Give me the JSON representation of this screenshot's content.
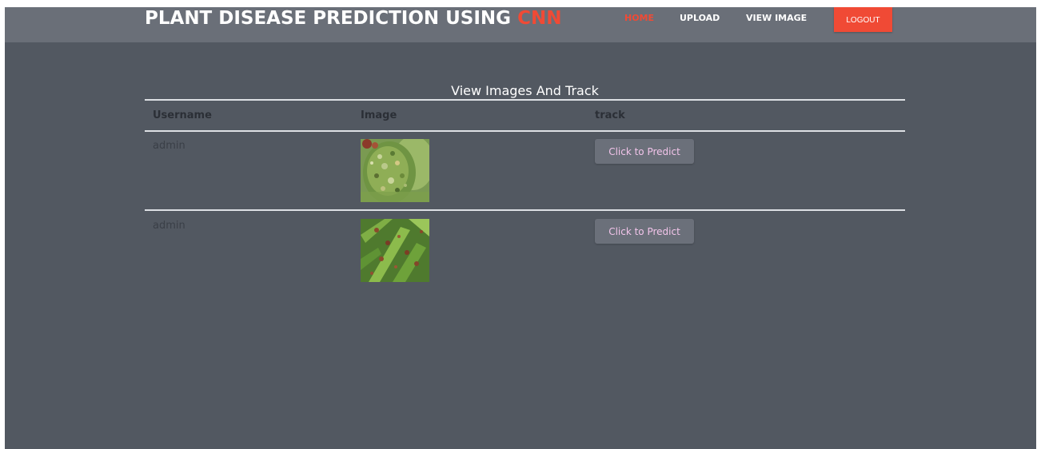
{
  "header": {
    "brand_prefix": "PLANT DISEASE PREDICTION USING ",
    "brand_accent": "CNN",
    "nav": {
      "home": "HOME",
      "upload": "UPLOAD",
      "view_image": "VIEW IMAGE",
      "logout": "LOGOUT"
    }
  },
  "main": {
    "title": "View Images And Track",
    "columns": [
      "Username",
      "Image",
      "track"
    ],
    "rows": [
      {
        "username": "admin",
        "image_icon": "leaf-photo",
        "action": "Click to Predict"
      },
      {
        "username": "admin",
        "image_icon": "leaf-photo",
        "action": "Click to Predict"
      }
    ]
  },
  "colors": {
    "background": "#525861",
    "header": "#6a6f78",
    "accent": "#f04a35",
    "button": "#6b707a",
    "button_text": "#f2c4ea"
  }
}
